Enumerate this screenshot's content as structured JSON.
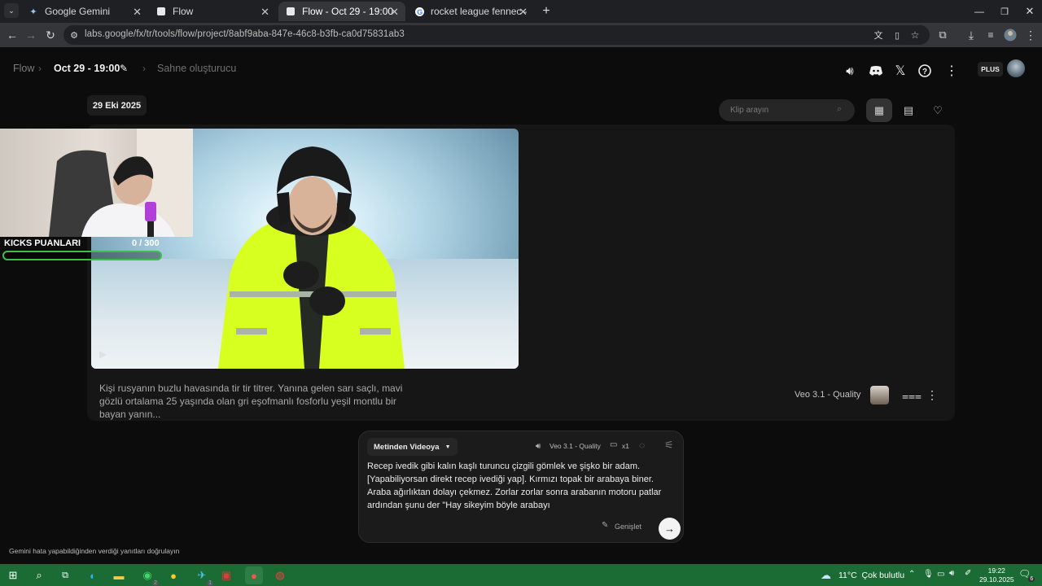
{
  "browser": {
    "tabs": [
      {
        "title": "Google Gemini",
        "icon": "gemini-sparkle-icon"
      },
      {
        "title": "Flow",
        "icon": "flow-icon"
      },
      {
        "title": "Flow - Oct 29 - 19:00",
        "icon": "flow-icon"
      },
      {
        "title": "rocket league fennec - Google'",
        "icon": "google-icon"
      }
    ],
    "url": "labs.google/fx/tr/tools/flow/project/8abf9aba-847e-46c8-b3fb-ca0d75831ab3",
    "url_host": "labs.google"
  },
  "header": {
    "app": "Flow",
    "project": "Oct 29 - 19:00",
    "scene": "Sahne oluşturucu",
    "plan_badge": "PLUS"
  },
  "toolbar": {
    "date_chip": "29 Eki 2025",
    "search_placeholder": "Klip arayın"
  },
  "clip": {
    "watermark": "Veo",
    "description": "Kişi rusyanın buzlu havasında tir tir titrer. Yanına gelen sarı saçlı, mavi gözlü ortalama 25 yaşında olan gri eşofmanlı fosforlu yeşil montlu bir bayan yanın...",
    "model": "Veo 3.1 - Quality"
  },
  "overlay": {
    "kicks_label": "KICKS PUANLARI",
    "kicks_count": "0  / 300",
    "kicks_progress": 0
  },
  "composer": {
    "mode": "Metinden Videoya",
    "model": "Veo 3.1 - Quality",
    "count": "x1",
    "text": "Recep ivedik gibi kalın kaşlı turuncu çizgili gömlek ve şişko bir adam. [Yapabiliyorsan direkt recep ivediği yap]. Kırmızı topak bir arabaya biner. Araba ağırlıktan dolayı çekmez. Zorlar zorlar sonra arabanın motoru patlar ardından şunu der \"Hay sikeyim böyle arabayı",
    "expand_label": "Genişlet"
  },
  "footer_note": "Gemini hata yapabildiğinden verdiği yanıtları doğrulayın",
  "taskbar": {
    "weather_temp": "11°C",
    "weather_text": "Çok bulutlu",
    "time": "19:22",
    "date": "29.10.2025",
    "whatsapp_badge": "2",
    "app_badge": "1",
    "notif_count": "6"
  },
  "colors": {
    "taskbar": "#1b6b35",
    "progress_border": "#3bbf48",
    "jacket": "#d7ff1f"
  }
}
